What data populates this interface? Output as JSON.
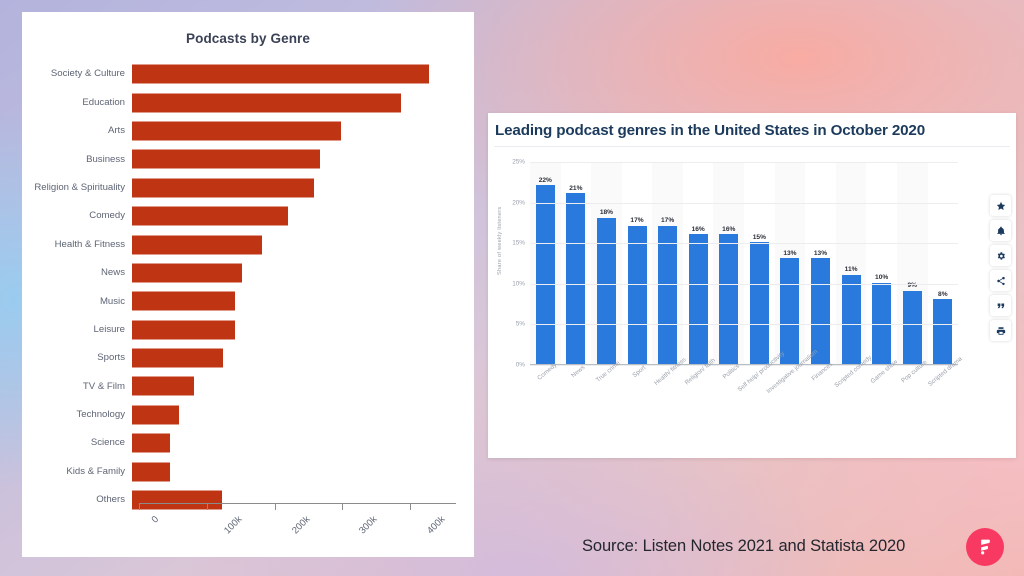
{
  "background": {
    "gradient_from": "#b3b3dd",
    "gradient_to": "#f2b8b3",
    "accent_blue": "#96cdf0",
    "accent_pink": "#faaaa0"
  },
  "left_panel": {
    "title": "Podcasts by Genre"
  },
  "right_panel": {
    "title": "Leading podcast genres in the United States in October 2020",
    "tools": [
      {
        "name": "favorite-icon",
        "label": "star"
      },
      {
        "name": "alert-icon",
        "label": "bell"
      },
      {
        "name": "settings-icon",
        "label": "gear"
      },
      {
        "name": "share-icon",
        "label": "share"
      },
      {
        "name": "cite-icon",
        "label": "quote"
      },
      {
        "name": "print-icon",
        "label": "print"
      }
    ]
  },
  "footer": {
    "source": "Source: Listen Notes 2021 and Statista 2020",
    "logo_color": "#f83a62"
  },
  "chart_data": [
    {
      "type": "bar",
      "orientation": "horizontal",
      "title": "Podcasts by Genre",
      "xlabel": "",
      "ylabel": "",
      "bar_color": "#bf3513",
      "xlim": [
        0,
        450000
      ],
      "xticks": [
        0,
        100000,
        200000,
        300000,
        400000
      ],
      "xtick_labels": [
        "0",
        "100k",
        "200k",
        "300k",
        "400k"
      ],
      "grid": false,
      "categories": [
        "Society & Culture",
        "Education",
        "Arts",
        "Business",
        "Religion & Spirituality",
        "Comedy",
        "Health & Fitness",
        "News",
        "Music",
        "Leisure",
        "Sports",
        "TV & Film",
        "Technology",
        "Science",
        "Kids & Family",
        "Others"
      ],
      "values": [
        438000,
        397000,
        309000,
        277000,
        268000,
        230000,
        192000,
        162000,
        152000,
        152000,
        135000,
        91000,
        70000,
        56000,
        56000,
        133000
      ]
    },
    {
      "type": "bar",
      "orientation": "vertical",
      "title": "Leading podcast genres in the United States in October 2020",
      "xlabel": "",
      "ylabel": "Share of weekly listeners",
      "bar_color": "#2a7ade",
      "ylim": [
        0,
        25
      ],
      "yticks": [
        0,
        5,
        10,
        15,
        20,
        25
      ],
      "ytick_labels": [
        "0%",
        "5%",
        "10%",
        "15%",
        "20%",
        "25%"
      ],
      "grid": true,
      "categories": [
        "Comedy",
        "News",
        "True crime",
        "Sport",
        "Health/ fitness",
        "Religion/ faith",
        "Politics",
        "Self help/ productivity",
        "Investigative journalism",
        "Finances",
        "Scripted comedy",
        "Game show",
        "Pop culture",
        "Scripted drama"
      ],
      "values": [
        22,
        21,
        18,
        17,
        17,
        16,
        16,
        15,
        13,
        13,
        11,
        10,
        9,
        8
      ],
      "value_labels": [
        "22%",
        "21%",
        "18%",
        "17%",
        "17%",
        "16%",
        "16%",
        "15%",
        "13%",
        "13%",
        "11%",
        "10%",
        "9%",
        "8%"
      ]
    }
  ]
}
